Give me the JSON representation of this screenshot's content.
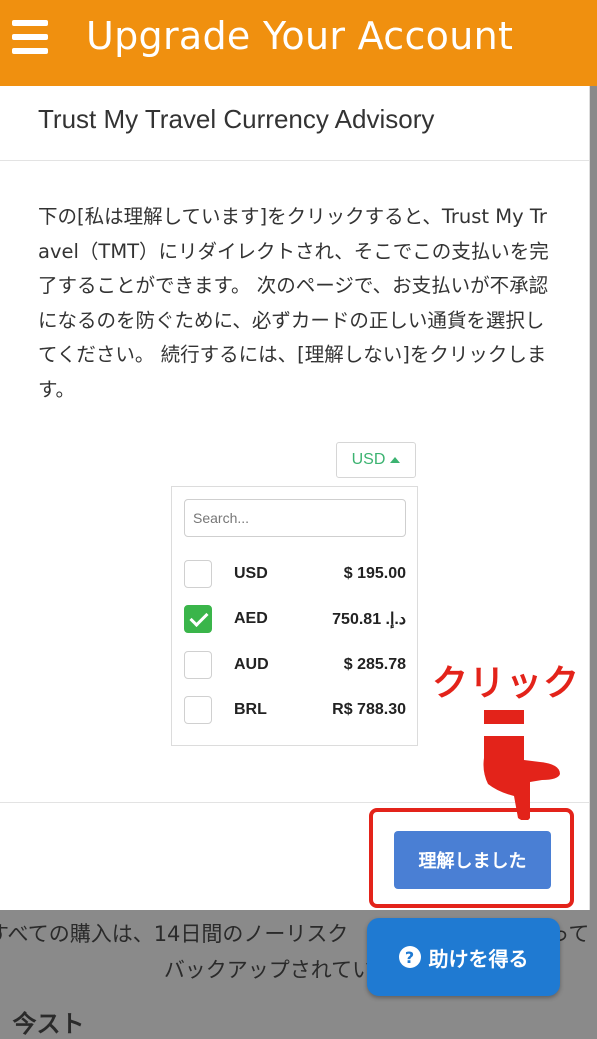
{
  "header": {
    "title": "Upgrade Your Account"
  },
  "modal": {
    "title": "Trust My Travel Currency Advisory",
    "advisory": "下の[私は理解しています]をクリックすると、Trust My Travel（TMT）にリダイレクトされ、そこでこの支払いを完了することができます。 次のページで、お支払いが不承認になるのを防ぐために、必ずカードの正しい通貨を選択してください。 続行するには、[理解しない]をクリックします。",
    "currency_toggle": "USD",
    "search_placeholder": "Search...",
    "currencies": [
      {
        "code": "USD",
        "amount": "$ 195.00",
        "checked": false
      },
      {
        "code": "AED",
        "amount": "750.81 .د.إ",
        "checked": true
      },
      {
        "code": "AUD",
        "amount": "$ 285.78",
        "checked": false
      },
      {
        "code": "BRL",
        "amount": "R$ 788.30",
        "checked": false
      }
    ],
    "confirm_button": "理解しました"
  },
  "annotation": {
    "click_label": "クリック",
    "color": "#e3231a"
  },
  "background": {
    "line1": "すべての購入は、14日間のノーリスク",
    "line1_end": "って",
    "line2": "バックアップされてい",
    "line3": "今スト"
  },
  "help": {
    "label": "助けを得る",
    "icon": "?"
  },
  "colors": {
    "topbar": "#f0900f",
    "confirm": "#4a7fd4",
    "help": "#1f7ad2",
    "check": "#3ab54a"
  }
}
